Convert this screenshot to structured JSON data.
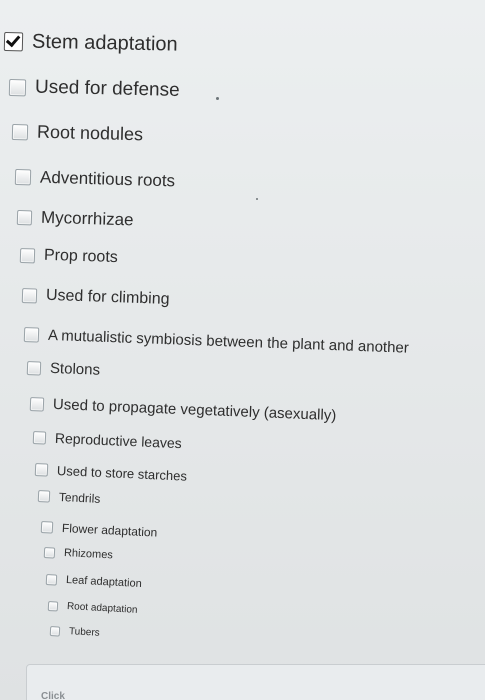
{
  "items": [
    {
      "label": "Stem adaptation",
      "checked": true
    },
    {
      "label": "Used for defense",
      "checked": false
    },
    {
      "label": "Root nodules",
      "checked": false
    },
    {
      "label": "Adventitious roots",
      "checked": false
    },
    {
      "label": "Mycorrhizae",
      "checked": false
    },
    {
      "label": "Prop roots",
      "checked": false
    },
    {
      "label": "Used for climbing",
      "checked": false
    },
    {
      "label": "A mutualistic symbiosis between the plant and another",
      "checked": false
    },
    {
      "label": "Stolons",
      "checked": false
    },
    {
      "label": "Used to propagate vegetatively (asexually)",
      "checked": false
    },
    {
      "label": "Reproductive leaves",
      "checked": false
    },
    {
      "label": "Used to store starches",
      "checked": false
    },
    {
      "label": "Tendrils",
      "checked": false
    },
    {
      "label": "Flower adaptation",
      "checked": false
    },
    {
      "label": "Rhizomes",
      "checked": false
    },
    {
      "label": "Leaf adaptation",
      "checked": false
    },
    {
      "label": "Root adaptation",
      "checked": false
    },
    {
      "label": "Tubers",
      "checked": false
    }
  ],
  "footer": {
    "text": "Click"
  }
}
